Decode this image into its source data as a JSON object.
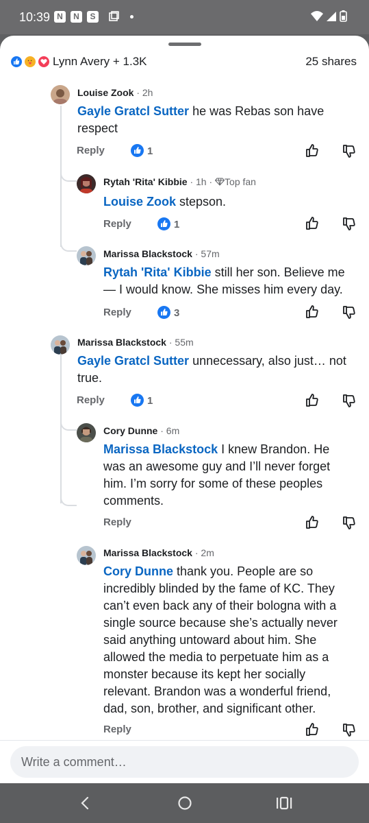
{
  "status_bar": {
    "time": "10:39",
    "notif_icons": [
      "N",
      "N",
      "S"
    ]
  },
  "reactions": {
    "summary": "Lynn Avery + 1.3K",
    "shares": "25 shares"
  },
  "labels": {
    "reply": "Reply"
  },
  "comments": [
    {
      "author": "Louise Zook",
      "time": "· 2h",
      "mention": "Gayle Gratcl Sutter",
      "text_1": " he was Rebas son have",
      "text_2": "respect",
      "likes": "1"
    },
    {
      "author": "Rytah 'Rita' Kibbie",
      "time": "· 1h ·",
      "badge": "Top fan",
      "mention": "Louise Zook",
      "text_1": " stepson.",
      "likes": "1"
    },
    {
      "author": "Marissa Blackstock",
      "time": "· 57m",
      "mention": "Rytah 'Rita' Kibbie",
      "text_1": " still her son. Believe me",
      "text_2": "— I would know. She misses him every day.",
      "likes": "3"
    },
    {
      "author": "Marissa Blackstock",
      "time": "· 55m",
      "mention": "Gayle Gratcl Sutter",
      "text_1": " unnecessary, also just… not",
      "text_2": "true.",
      "likes": "1"
    },
    {
      "author": "Cory Dunne",
      "time": "· 6m",
      "mention": "Marissa Blackstock",
      "text_1": " I knew Brandon. He",
      "text_2": "was an awesome guy and I’ll never forget",
      "text_3": "him. I’m sorry for some of these peoples",
      "text_4": "comments."
    },
    {
      "author": "Marissa Blackstock",
      "time": "· 2m",
      "mention": "Cory Dunne",
      "text_1": " thank you. People are so",
      "text_2": "incredibly blinded by the fame of KC. They",
      "text_3": "can’t even back any of their bologna with a",
      "text_4": "single source because she’s actually never",
      "text_5": "said anything untoward about him. She",
      "text_6": "allowed the media to perpetuate him as a",
      "text_7": "monster because its kept her socially",
      "text_8": "relevant. Brandon was a wonderful friend,",
      "text_9": "dad, son, brother, and significant other."
    }
  ],
  "composer": {
    "placeholder": "Write a comment…"
  },
  "colors": {
    "accent": "#1877f2",
    "mention": "#0a66c2",
    "muted": "#65676b"
  },
  "icons": [
    "signal-icon",
    "wifi-icon",
    "battery-icon",
    "like-icon",
    "care-icon",
    "love-icon",
    "thumbs-up-icon",
    "thumbs-down-icon",
    "diamond-icon",
    "back-icon",
    "home-icon",
    "recents-icon"
  ]
}
